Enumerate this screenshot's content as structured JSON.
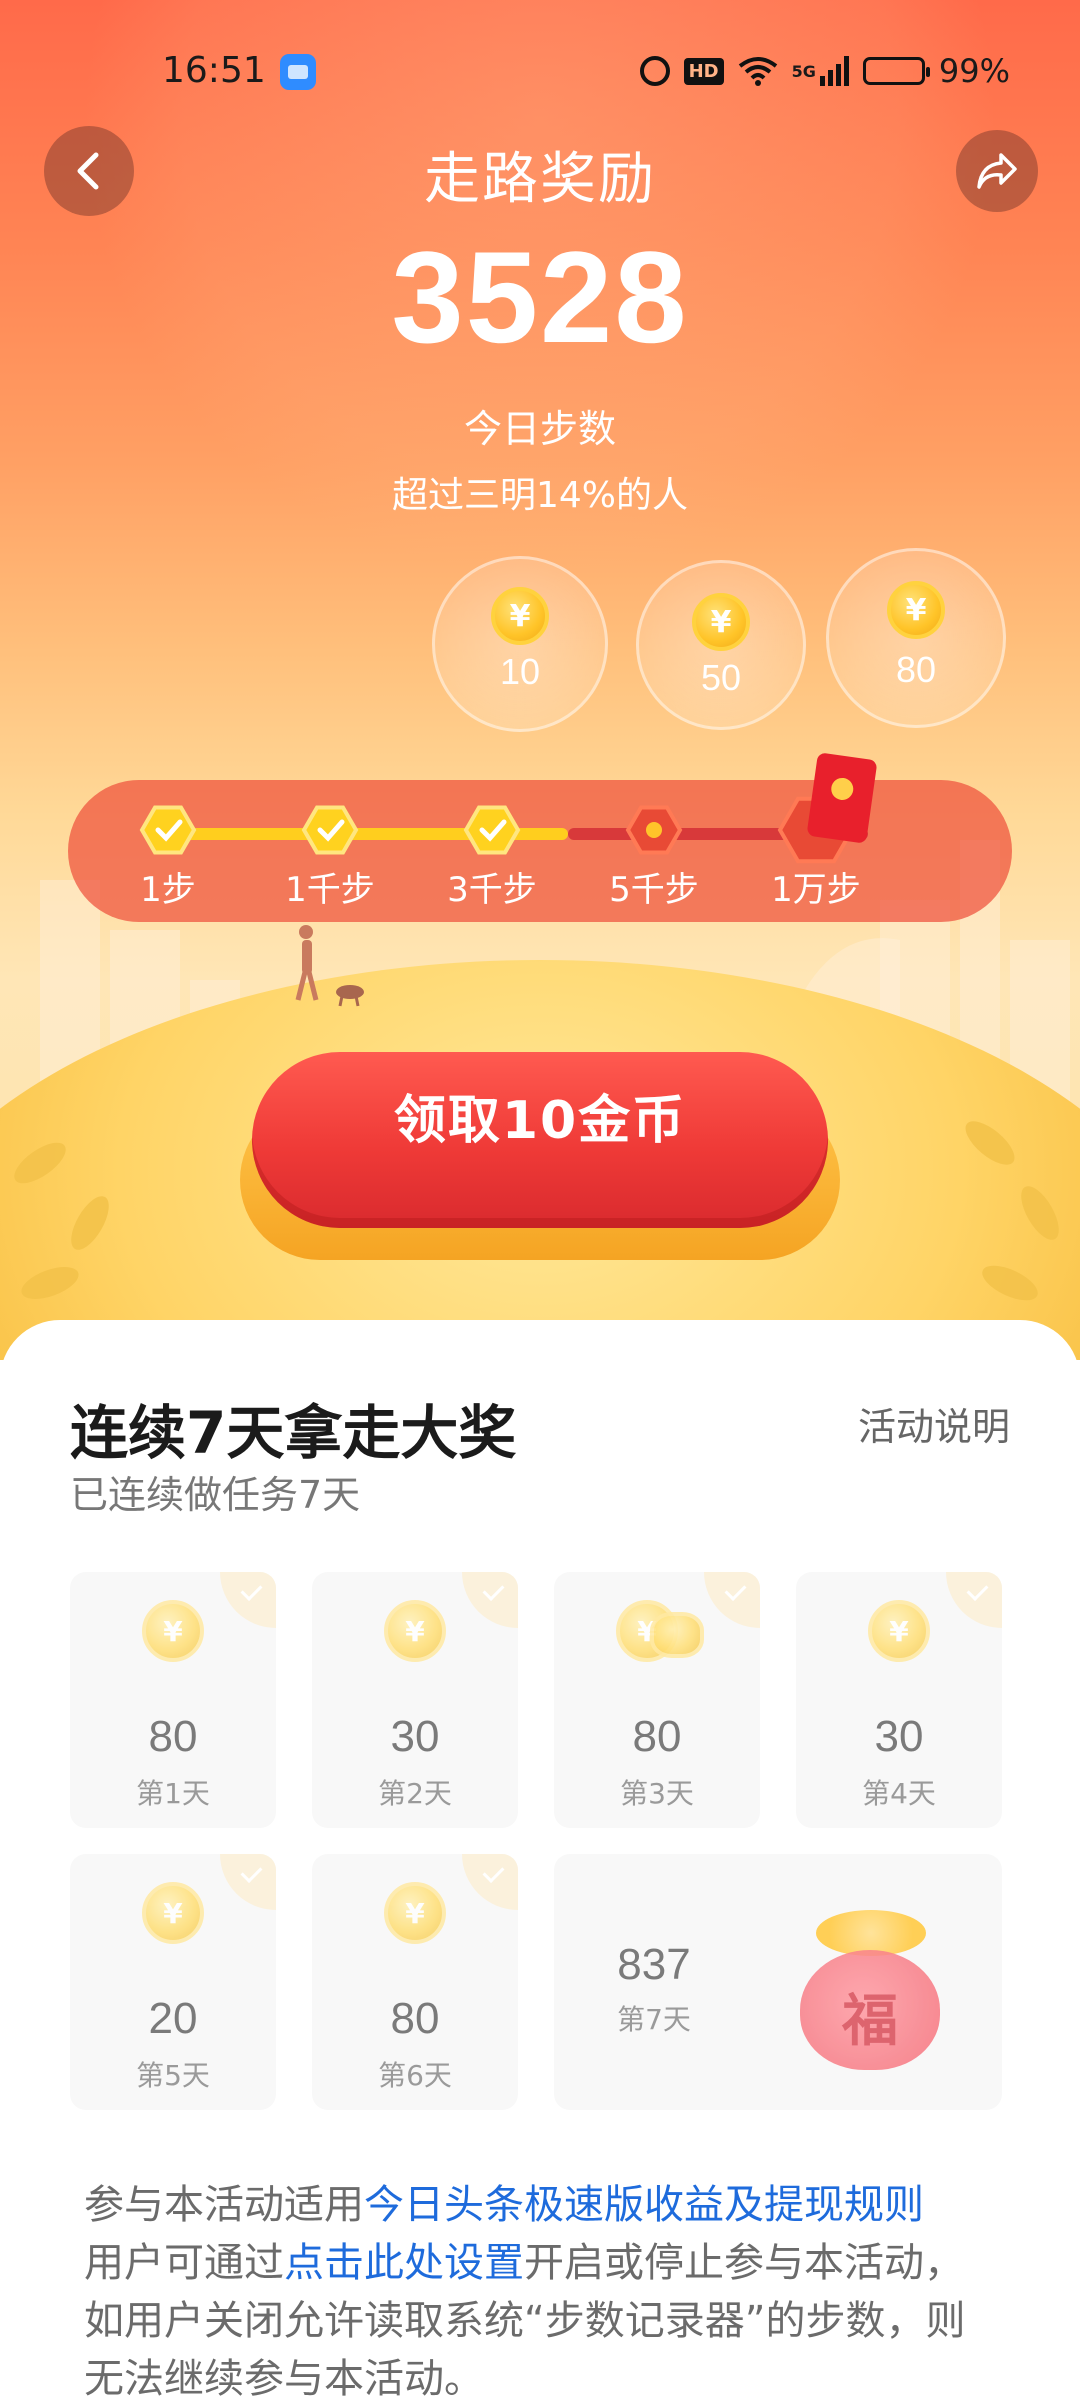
{
  "status_bar": {
    "time": "16:51",
    "hd_badge": "HD",
    "network": "5G",
    "battery": "99%",
    "battery_level": 0.99
  },
  "header": {
    "title": "走路奖励"
  },
  "steps": {
    "count": "3528",
    "label": "今日步数",
    "rank_text": "超过三明14%的人"
  },
  "bubbles": [
    {
      "coin_symbol": "¥",
      "value": "10"
    },
    {
      "coin_symbol": "¥",
      "value": "50"
    },
    {
      "coin_symbol": "¥",
      "value": "80"
    }
  ],
  "milestones": [
    {
      "label": "1步",
      "done": true
    },
    {
      "label": "1千步",
      "done": true
    },
    {
      "label": "3千步",
      "done": true
    },
    {
      "label": "5千步",
      "done": false
    },
    {
      "label": "1万步",
      "done": false
    }
  ],
  "claim_button": {
    "label": "领取10金币"
  },
  "streak": {
    "title": "连续7天拿走大奖",
    "rules_link": "活动说明",
    "subtitle": "已连续做任务7天",
    "days": [
      {
        "value": "80",
        "label": "第1天"
      },
      {
        "value": "30",
        "label": "第2天"
      },
      {
        "value": "80",
        "label": "第3天"
      },
      {
        "value": "30",
        "label": "第4天"
      },
      {
        "value": "20",
        "label": "第5天"
      },
      {
        "value": "80",
        "label": "第6天"
      },
      {
        "value": "837",
        "label": "第7天"
      }
    ],
    "bag_char": "福"
  },
  "notice": {
    "line1_prefix": "参与本活动适用",
    "line1_link": "今日头条极速版收益及提现规则",
    "line2_prefix": "用户可通过",
    "line2_link": "点击此处设置",
    "line2_suffix": "开启或停止参与本活动，",
    "line3": "如用户关闭允许读取系统“步数记录器”的步数，则",
    "line4": "无法继续参与本活动。"
  },
  "colors": {
    "hero_top": "#ff6a4a",
    "claim_red": "#ef3a37",
    "coin_gold": "#ffc428",
    "link_blue": "#1e6bdc"
  }
}
